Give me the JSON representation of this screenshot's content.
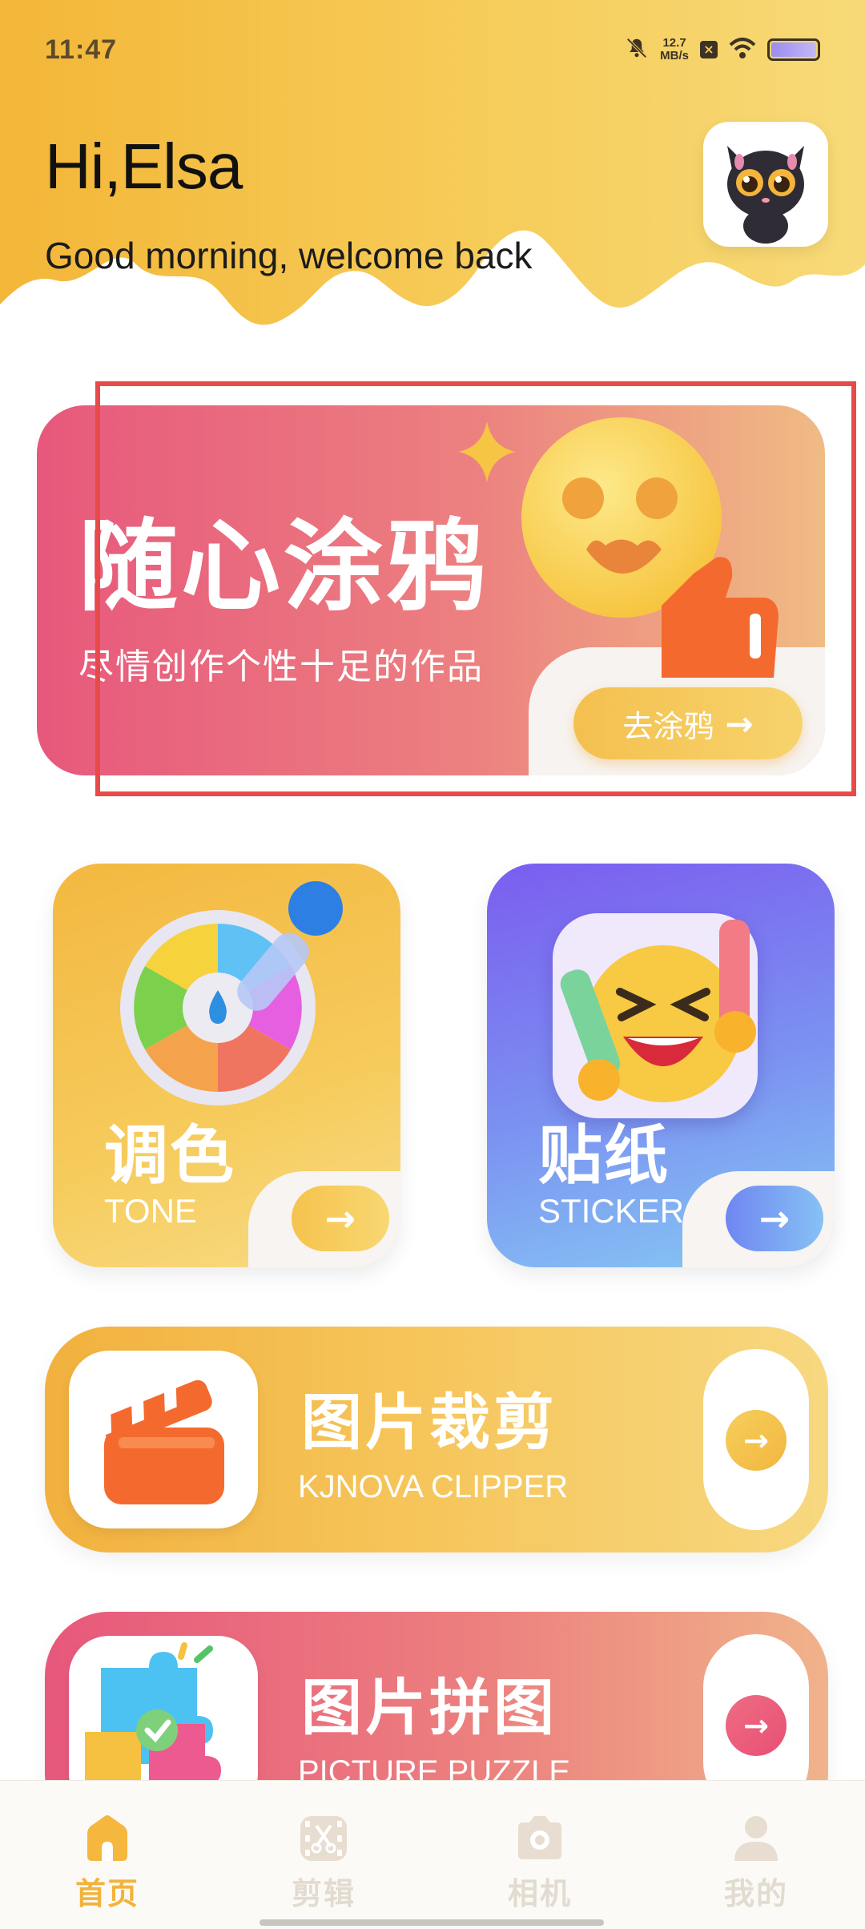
{
  "status_bar": {
    "time": "11:47",
    "speed_value": "12.7",
    "speed_unit": "MB/s"
  },
  "header": {
    "greeting": "Hi,Elsa",
    "subtitle": "Good morning, welcome back"
  },
  "banner": {
    "title": "随心涂鸦",
    "subtitle": "尽情创作个性十足的作品",
    "button_label": "去涂鸦"
  },
  "cards": [
    {
      "title": "调色",
      "subtitle": "TONE"
    },
    {
      "title": "贴纸",
      "subtitle": "STICKER"
    }
  ],
  "features": [
    {
      "title": "图片裁剪",
      "subtitle": "KJNOVA CLIPPER"
    },
    {
      "title": "图片拼图",
      "subtitle": "PICTURE PUZZLE"
    }
  ],
  "tabbar": {
    "active": "首页",
    "items": [
      {
        "label": "首页",
        "icon": "home-icon"
      },
      {
        "label": "剪辑",
        "icon": "scissors-film-icon"
      },
      {
        "label": "相机",
        "icon": "camera-icon"
      },
      {
        "label": "我的",
        "icon": "person-icon"
      }
    ]
  },
  "colors": {
    "accent": "#f2b33c",
    "pink": "#e7587c",
    "purple": "#7b5df0",
    "highlight_box": "#e84a4a"
  }
}
